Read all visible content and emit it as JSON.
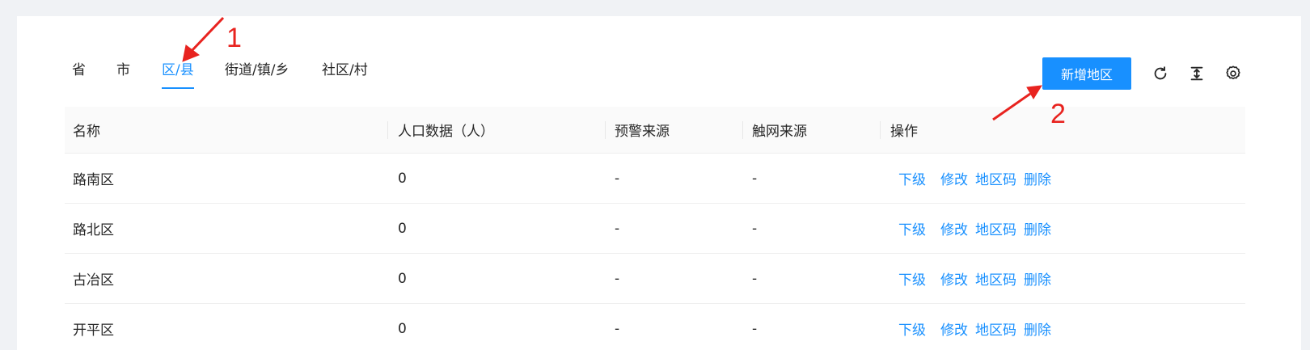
{
  "tabs": [
    {
      "label": "省"
    },
    {
      "label": "市"
    },
    {
      "label": "区/县"
    },
    {
      "label": "街道/镇/乡"
    },
    {
      "label": "社区/村"
    }
  ],
  "active_tab": "区/县",
  "toolbar": {
    "add_label": "新增地区",
    "refresh_icon": "refresh-icon",
    "density_icon": "column-height-icon",
    "settings_icon": "gear-icon"
  },
  "table": {
    "columns": [
      "名称",
      "人口数据（人）",
      "预警来源",
      "触网来源",
      "操作"
    ],
    "rows": [
      {
        "name": "路南区",
        "population": "0",
        "warning": "-",
        "net": "-"
      },
      {
        "name": "路北区",
        "population": "0",
        "warning": "-",
        "net": "-"
      },
      {
        "name": "古冶区",
        "population": "0",
        "warning": "-",
        "net": "-"
      },
      {
        "name": "开平区",
        "population": "0",
        "warning": "-",
        "net": "-"
      }
    ],
    "actions": [
      "下级",
      "修改",
      "地区码",
      "删除"
    ]
  },
  "annotations": [
    "1",
    "2"
  ],
  "colors": {
    "accent": "#1890ff",
    "annotation": "#e8231f"
  }
}
